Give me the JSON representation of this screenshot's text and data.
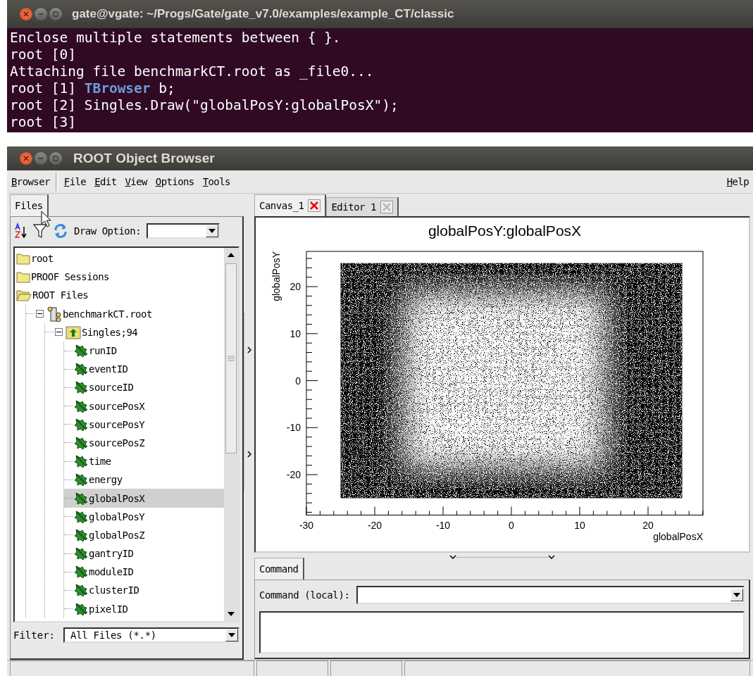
{
  "terminal": {
    "title": "gate@vgate: ~/Progs/Gate/gate_v7.0/examples/example_CT/classic",
    "lines": [
      [
        {
          "text": "Enclose multiple statements between { }.",
          "kind": "plain"
        }
      ],
      [
        {
          "text": "root [0]",
          "kind": "plain"
        }
      ],
      [
        {
          "text": "Attaching file benchmarkCT.root as _file0...",
          "kind": "plain"
        }
      ],
      [
        {
          "text": "root [1] ",
          "kind": "plain"
        },
        {
          "text": "TBrowser",
          "kind": "keyword"
        },
        {
          "text": " b;",
          "kind": "plain"
        }
      ],
      [
        {
          "text": "root [2] Singles.Draw(\"globalPosY:globalPosX\");",
          "kind": "plain"
        }
      ],
      [
        {
          "text": "root [3]",
          "kind": "plain"
        }
      ]
    ]
  },
  "browser": {
    "title": "ROOT Object Browser",
    "menu": [
      {
        "label": "Browser"
      },
      {
        "label": "File"
      },
      {
        "label": "Edit"
      },
      {
        "label": "View"
      },
      {
        "label": "Options"
      },
      {
        "label": "Tools"
      }
    ],
    "help": "Help",
    "left": {
      "tabs": [
        {
          "label": "Files",
          "selected": true
        }
      ],
      "draw_option_label": "Draw Option:",
      "tree": [
        {
          "label": "root",
          "kind": "folder",
          "selected": false
        },
        {
          "label": "PROOF Sessions",
          "kind": "folder",
          "selected": false
        },
        {
          "label": "ROOT Files",
          "kind": "open-folder",
          "selected": false,
          "children": [
            {
              "label": "benchmarkCT.root",
              "kind": "file",
              "expanded": true,
              "selected": false,
              "children": [
                {
                  "label": "Singles;94",
                  "kind": "tree",
                  "expanded": true,
                  "selected": false,
                  "children": [
                    {
                      "label": "runID",
                      "kind": "leaf",
                      "selected": false
                    },
                    {
                      "label": "eventID",
                      "kind": "leaf",
                      "selected": false
                    },
                    {
                      "label": "sourceID",
                      "kind": "leaf",
                      "selected": false
                    },
                    {
                      "label": "sourcePosX",
                      "kind": "leaf",
                      "selected": false
                    },
                    {
                      "label": "sourcePosY",
                      "kind": "leaf",
                      "selected": false
                    },
                    {
                      "label": "sourcePosZ",
                      "kind": "leaf",
                      "selected": false
                    },
                    {
                      "label": "time",
                      "kind": "leaf",
                      "selected": false
                    },
                    {
                      "label": "energy",
                      "kind": "leaf",
                      "selected": false
                    },
                    {
                      "label": "globalPosX",
                      "kind": "leaf",
                      "selected": true
                    },
                    {
                      "label": "globalPosY",
                      "kind": "leaf",
                      "selected": false
                    },
                    {
                      "label": "globalPosZ",
                      "kind": "leaf",
                      "selected": false
                    },
                    {
                      "label": "gantryID",
                      "kind": "leaf",
                      "selected": false
                    },
                    {
                      "label": "moduleID",
                      "kind": "leaf",
                      "selected": false
                    },
                    {
                      "label": "clusterID",
                      "kind": "leaf",
                      "selected": false
                    },
                    {
                      "label": "pixelID",
                      "kind": "leaf",
                      "selected": false
                    }
                  ]
                }
              ]
            }
          ]
        }
      ],
      "filter_label": "Filter:",
      "filter_value": "All Files (*.*)"
    },
    "right": {
      "tabs": [
        {
          "label": "Canvas_1",
          "selected": true,
          "close_enabled": true
        },
        {
          "label": "Editor 1",
          "selected": false,
          "close_enabled": false
        }
      ],
      "plot": {
        "title": "globalPosY:globalPosX",
        "xlabel": "globalPosX",
        "ylabel": "globalPosY",
        "xticks": [
          "-30",
          "-20",
          "-10",
          "0",
          "10",
          "20"
        ],
        "yticks": [
          "20",
          "10",
          "0",
          "-10",
          "-20"
        ]
      },
      "command_tabs": [
        {
          "label": "Command",
          "selected": true
        }
      ],
      "command_label": "Command (local):"
    }
  }
}
